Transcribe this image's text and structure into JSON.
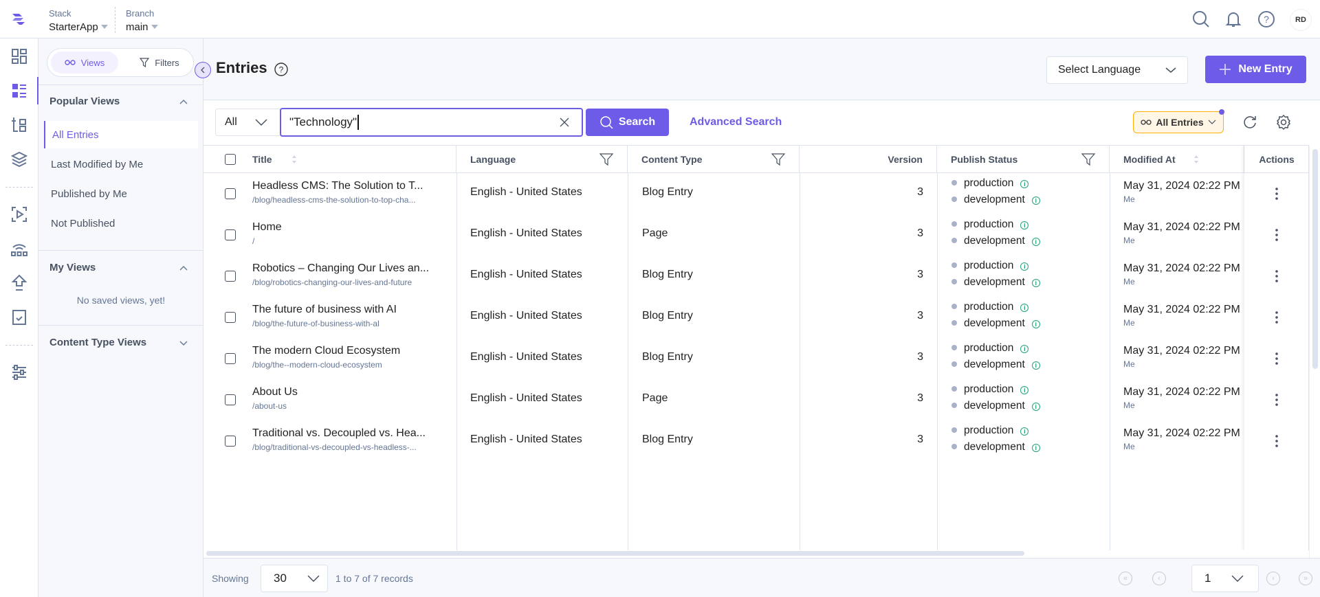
{
  "topbar": {
    "stack_label": "Stack",
    "stack_value": "StarterApp",
    "branch_label": "Branch",
    "branch_value": "main",
    "avatar_initials": "RD"
  },
  "sidebar": {
    "tabs": {
      "views": "Views",
      "filters": "Filters"
    },
    "popular_views": {
      "title": "Popular Views",
      "items": [
        {
          "label": "All Entries",
          "active": true
        },
        {
          "label": "Last Modified by Me"
        },
        {
          "label": "Published by Me"
        },
        {
          "label": "Not Published"
        }
      ]
    },
    "my_views": {
      "title": "My Views",
      "empty": "No saved views, yet!"
    },
    "content_type_views": {
      "title": "Content Type Views"
    }
  },
  "header": {
    "title": "Entries",
    "select_language": "Select Language",
    "new_entry": "New Entry"
  },
  "toolbar": {
    "scope": "All",
    "search_value": "\"Technology\"",
    "search_button": "Search",
    "advanced_search": "Advanced Search",
    "view_selector": "All Entries"
  },
  "table": {
    "columns": [
      "Title",
      "Language",
      "Content Type",
      "Version",
      "Publish Status",
      "Modified At",
      "Actions"
    ],
    "rows": [
      {
        "title": "Headless CMS: The Solution to T...",
        "slug": "/blog/headless-cms-the-solution-to-top-cha...",
        "language": "English - United States",
        "content_type": "Blog Entry",
        "version": "3",
        "statuses": [
          "production",
          "development"
        ],
        "modified_at": "May 31, 2024 02:22 PM",
        "modified_by": "Me"
      },
      {
        "title": "Home",
        "slug": "/",
        "language": "English - United States",
        "content_type": "Page",
        "version": "3",
        "statuses": [
          "production",
          "development"
        ],
        "modified_at": "May 31, 2024 02:22 PM",
        "modified_by": "Me"
      },
      {
        "title": "Robotics – Changing Our Lives an...",
        "slug": "/blog/robotics-changing-our-lives-and-future",
        "language": "English - United States",
        "content_type": "Blog Entry",
        "version": "3",
        "statuses": [
          "production",
          "development"
        ],
        "modified_at": "May 31, 2024 02:22 PM",
        "modified_by": "Me"
      },
      {
        "title": "The future of business with AI",
        "slug": "/blog/the-future-of-business-with-al",
        "language": "English - United States",
        "content_type": "Blog Entry",
        "version": "3",
        "statuses": [
          "production",
          "development"
        ],
        "modified_at": "May 31, 2024 02:22 PM",
        "modified_by": "Me"
      },
      {
        "title": "The modern Cloud Ecosystem",
        "slug": "/blog/the--modern-cloud-ecosystem",
        "language": "English - United States",
        "content_type": "Blog Entry",
        "version": "3",
        "statuses": [
          "production",
          "development"
        ],
        "modified_at": "May 31, 2024 02:22 PM",
        "modified_by": "Me"
      },
      {
        "title": "About Us",
        "slug": "/about-us",
        "language": "English - United States",
        "content_type": "Page",
        "version": "3",
        "statuses": [
          "production",
          "development"
        ],
        "modified_at": "May 31, 2024 02:22 PM",
        "modified_by": "Me"
      },
      {
        "title": "Traditional vs. Decoupled vs. Hea...",
        "slug": "/blog/traditional-vs-decoupled-vs-headless-...",
        "language": "English - United States",
        "content_type": "Blog Entry",
        "version": "3",
        "statuses": [
          "production",
          "development"
        ],
        "modified_at": "May 31, 2024 02:22 PM",
        "modified_by": "Me"
      }
    ]
  },
  "footer": {
    "showing_label": "Showing",
    "page_size": "30",
    "records": "1 to 7 of 7 records",
    "page": "1"
  },
  "colors": {
    "accent": "#6c5ce7",
    "status_info": "#1ea672",
    "view_pill_border": "#ffae0a"
  }
}
